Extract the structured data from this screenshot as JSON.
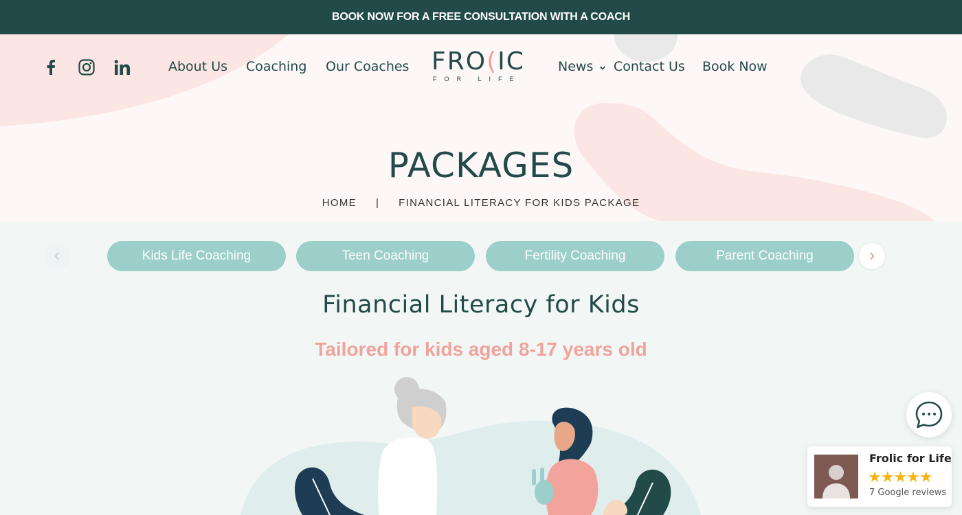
{
  "announcement": {
    "text": "BOOK NOW FOR A FREE CONSULTATION WITH A COACH"
  },
  "social": {
    "icons": [
      "facebook-icon",
      "instagram-icon",
      "linkedin-icon"
    ]
  },
  "nav": {
    "left": [
      "About Us",
      "Coaching",
      "Our Coaches"
    ],
    "right": [
      "News",
      "Contact Us",
      "Book Now"
    ]
  },
  "logo": {
    "word_a": "FRO",
    "word_b": "IC",
    "sub": "FOR LIFE"
  },
  "hero": {
    "title": "PACKAGES",
    "breadcrumb": {
      "home": "HOME",
      "separator": "|",
      "current": "FINANCIAL LITERACY FOR KIDS PACKAGE"
    }
  },
  "tabs": [
    "Kids Life Coaching",
    "Teen Coaching",
    "Fertility Coaching",
    "Parent Coaching"
  ],
  "section": {
    "title": "Financial Literacy for Kids",
    "subtitle": "Tailored for kids aged 8-17 years old"
  },
  "review": {
    "name": "Frolic for Life",
    "stars": "★★★★★",
    "count": "7 Google reviews"
  },
  "colors": {
    "primary": "#224a48",
    "accent": "#efa39c",
    "pill": "#9ccfca",
    "hero_bg": "#fdf8f7",
    "page_bg": "#f2f7f6",
    "star": "#f6b511"
  }
}
